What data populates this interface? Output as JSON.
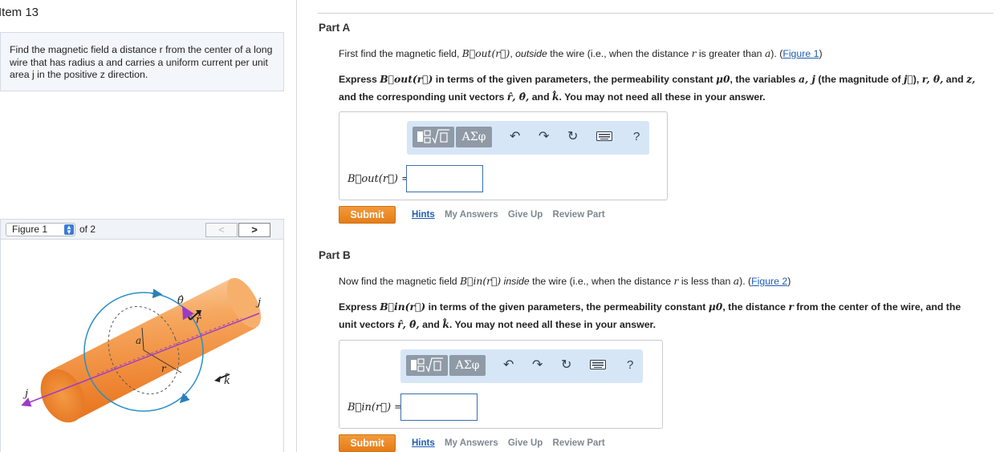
{
  "item_title": "Item 13",
  "problem": {
    "text": "Find the magnetic field a distance r from the center of a long wire that has radius a and carries a uniform current per unit area j in the positive z direction."
  },
  "figure_nav": {
    "selected": "Figure 1",
    "of_label": "of 2",
    "prev_label": "<",
    "next_label": ">"
  },
  "figure": {
    "labels": {
      "theta": "θ̂",
      "r": "r̂",
      "j_right": "j",
      "j_left": "j",
      "a": "a",
      "r_radius": "r",
      "k": "k̂"
    },
    "colors": {
      "cylinder": "#f08a2c",
      "circle": "#3399cc",
      "arrow": "#9b3bc7"
    }
  },
  "partA": {
    "title": "Part A",
    "intro_1": "First find the magnetic field, ",
    "sym_bout": "B⃗out(r⃗)",
    "intro_2": ", ",
    "intro_em": "outside",
    "intro_3": " the wire (i.e., when the distance ",
    "intro_r": "r",
    "intro_4": " is greater than ",
    "intro_a": "a",
    "intro_5": "). (",
    "figure_link": "Figure 1",
    "intro_6": ")",
    "express_1": "Express ",
    "express_sym": "B⃗out(r⃗)",
    "express_2": " in terms of the given parameters, the permeability constant ",
    "express_mu": "μ0",
    "express_3": ", the variables ",
    "express_vars": "a, j",
    "express_4": " (the magnitude of ",
    "express_jvec": "j⃗",
    "express_5": "), ",
    "express_vars2": "r, θ,",
    "express_6": " and ",
    "express_z": "z,",
    "express_line2_1": "and the corresponding unit vectors ",
    "express_units": "r̂, θ̂,",
    "express_line2_2": " and ",
    "express_k": "k̂",
    "express_line2_3": ". You may not need all these in your answer.",
    "answer_label": "B⃗out(r⃗) =",
    "answer_value": "",
    "submit": "Submit",
    "links": [
      "Hints",
      "My Answers",
      "Give Up",
      "Review Part"
    ]
  },
  "partB": {
    "title": "Part B",
    "intro_1": "Now find the magnetic field ",
    "sym_bin": "B⃗in(r⃗)",
    "intro_em": "inside",
    "intro_3": " the wire (i.e., when the distance ",
    "intro_r": "r",
    "intro_4": " is less than ",
    "intro_a": "a",
    "intro_5": "). (",
    "figure_link": "Figure 2",
    "intro_6": ")",
    "express_1": "Express ",
    "express_sym": "B⃗in(r⃗)",
    "express_2": " in terms of the given parameters, the permeability constant ",
    "express_mu": "μ0",
    "express_3": ", the distance ",
    "express_r": "r",
    "express_4": " from the center of the wire, and the",
    "express_line2_1": "unit vectors ",
    "express_units": "r̂, θ̂,",
    "express_line2_2": " and ",
    "express_k": "k̂",
    "express_line2_3": ". You may not need all these in your answer.",
    "answer_label": "B⃗in(r⃗) =",
    "answer_value": "",
    "submit": "Submit",
    "links": [
      "Hints",
      "My Answers",
      "Give Up",
      "Review Part"
    ]
  },
  "toolbar": {
    "greek_label": "ΑΣφ",
    "templates_icon": "templates-icon",
    "undo_icon": "undo-icon",
    "redo_icon": "redo-icon",
    "reset_icon": "reset-icon",
    "keyboard_icon": "keyboard-icon",
    "help_label": "?"
  }
}
